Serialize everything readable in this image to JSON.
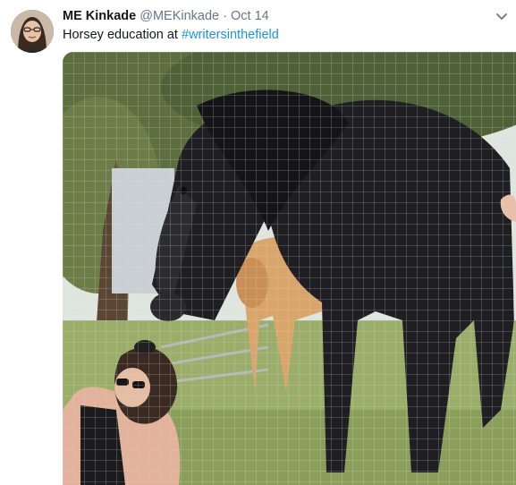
{
  "tweet": {
    "display_name": "ME Kinkade",
    "handle": "@MEKinkade",
    "separator": "·",
    "date": "Oct 14",
    "text": "Horsey education at ",
    "hashtag": "#writersinthefield",
    "avatar_icon": "user-avatar",
    "menu_icon": "chevron-down-icon"
  },
  "photo": {
    "description_icon": "horse-photo",
    "subjects": [
      "black horse",
      "palomino horse",
      "woman with sunglasses",
      "wire fence",
      "trees"
    ]
  },
  "colors": {
    "link": "#1b95e0",
    "name": "#14171a",
    "muted": "#657786"
  }
}
